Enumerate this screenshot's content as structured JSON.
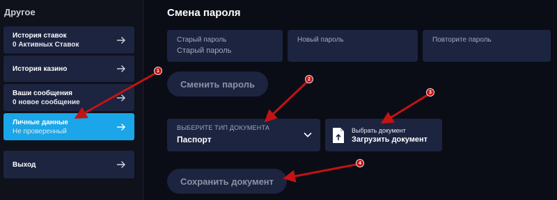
{
  "sidebar": {
    "title": "Другое",
    "items": [
      {
        "label": "История ставок",
        "sub": "0 Активных Ставок"
      },
      {
        "label": "История казино",
        "sub": ""
      },
      {
        "label": "Ваши сообщения",
        "sub": "0 новое сообщение"
      },
      {
        "label": "Личные данные",
        "sub": "Не проверенный"
      },
      {
        "label": "Выход",
        "sub": ""
      }
    ]
  },
  "password": {
    "title": "Смена пароля",
    "old_label": "Старый пароль",
    "old_value": "Старый пароль",
    "new_label": "Новый пароль",
    "repeat_label": "Повторите пароль",
    "submit_label": "Сменить пароль"
  },
  "document": {
    "type_label": "ВЫБЕРИТЕ ТИП ДОКУМЕНТА",
    "type_value": "Паспорт",
    "upload_hint": "Выбрать документ",
    "upload_label": "Загрузить документ",
    "save_label": "Сохранить документ"
  },
  "annotations": [
    "1",
    "2",
    "3",
    "4"
  ],
  "colors": {
    "background": "#0b0d16",
    "card": "#1c2440",
    "active": "#1aa6e8",
    "annotation": "#c41313"
  }
}
